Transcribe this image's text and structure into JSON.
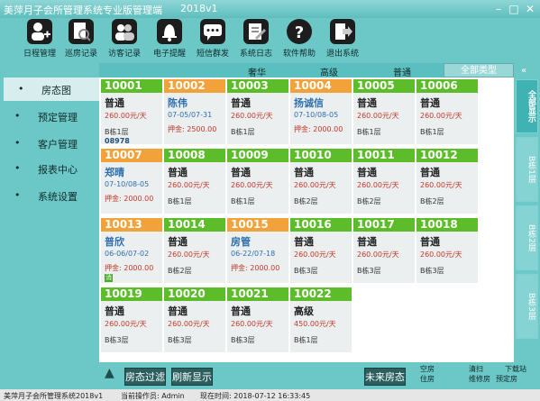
{
  "app": {
    "title": "美萍月子会所管理系统专业版管理端",
    "version": "2018v1"
  },
  "toolbar": [
    {
      "label": "日程管理",
      "icon": "user-add-icon"
    },
    {
      "label": "巡房记录",
      "icon": "document-search-icon"
    },
    {
      "label": "访客记录",
      "icon": "visitors-icon"
    },
    {
      "label": "电子提醒",
      "icon": "bell-icon"
    },
    {
      "label": "短信群发",
      "icon": "chat-icon"
    },
    {
      "label": "系统日志",
      "icon": "edit-log-icon"
    },
    {
      "label": "软件帮助",
      "icon": "help-icon"
    },
    {
      "label": "退出系统",
      "icon": "exit-icon"
    }
  ],
  "nav": [
    {
      "label": "房态图",
      "active": true
    },
    {
      "label": "预定管理",
      "active": false
    },
    {
      "label": "客户管理",
      "active": false
    },
    {
      "label": "报表中心",
      "active": false
    },
    {
      "label": "系统设置",
      "active": false
    }
  ],
  "categories": [
    "奢华",
    "高级",
    "普通",
    "全部类型"
  ],
  "rooms": [
    {
      "num": "10001",
      "color": "green",
      "type": "普通",
      "price": "260.00元/天",
      "floor": "B栋1层",
      "code": "08978"
    },
    {
      "num": "10002",
      "color": "orange",
      "type": "陈伟",
      "dates": "07-05/07-31",
      "deposit": "押金: 2500.00"
    },
    {
      "num": "10003",
      "color": "green",
      "type": "普通",
      "price": "260.00元/天",
      "floor": "B栋1层"
    },
    {
      "num": "10004",
      "color": "orange",
      "type": "扬诚信",
      "dates": "07-10/08-05",
      "deposit": "押金: 2000.00"
    },
    {
      "num": "10005",
      "color": "green",
      "type": "普通",
      "price": "260.00元/天",
      "floor": "B栋1层"
    },
    {
      "num": "10006",
      "color": "green",
      "type": "普通",
      "price": "260.00元/天",
      "floor": "B栋1层"
    },
    {
      "num": "10007",
      "color": "orange",
      "type": "郑晴",
      "dates": "07-10/08-05",
      "deposit": "押金: 2000.00"
    },
    {
      "num": "10008",
      "color": "green",
      "type": "普通",
      "price": "260.00元/天",
      "floor": "B栋1层"
    },
    {
      "num": "10009",
      "color": "green",
      "type": "普通",
      "price": "260.00元/天",
      "floor": "B栋1层"
    },
    {
      "num": "10010",
      "color": "green",
      "type": "普通",
      "price": "260.00元/天",
      "floor": "B栋2层"
    },
    {
      "num": "10011",
      "color": "green",
      "type": "普通",
      "price": "260.00元/天",
      "floor": "B栋2层"
    },
    {
      "num": "10012",
      "color": "green",
      "type": "普通",
      "price": "260.00元/天",
      "floor": "B栋2层"
    },
    {
      "num": "10013",
      "color": "orange",
      "type": "普欣",
      "dates": "06-06/07-02",
      "deposit": "押金: 2000.00",
      "badge": "消"
    },
    {
      "num": "10014",
      "color": "green",
      "type": "普通",
      "price": "260.00元/天",
      "floor": "B栋2层"
    },
    {
      "num": "10015",
      "color": "orange",
      "type": "房管",
      "dates": "06-22/07-18",
      "deposit": "押金: 2000.00"
    },
    {
      "num": "10016",
      "color": "green",
      "type": "普通",
      "price": "260.00元/天",
      "floor": "B栋3层"
    },
    {
      "num": "10017",
      "color": "green",
      "type": "普通",
      "price": "260.00元/天",
      "floor": "B栋3层"
    },
    {
      "num": "10018",
      "color": "green",
      "type": "普通",
      "price": "260.00元/天",
      "floor": "B栋3层"
    },
    {
      "num": "10019",
      "color": "green",
      "type": "普通",
      "price": "260.00元/天",
      "floor": "B栋3层"
    },
    {
      "num": "10020",
      "color": "green",
      "type": "普通",
      "price": "260.00元/天",
      "floor": "B栋3层"
    },
    {
      "num": "10021",
      "color": "green",
      "type": "普通",
      "price": "260.00元/天",
      "floor": "B栋3层"
    },
    {
      "num": "10022",
      "color": "green",
      "type": "高级",
      "price": "450.00元/天",
      "floor": "B栋1层"
    }
  ],
  "side_tabs": [
    "全部显示",
    "B栋1层",
    "B栋2层",
    "B栋3层"
  ],
  "bottom": {
    "filter": "房态过滤",
    "refresh": "刷新显示",
    "future": "未来房态",
    "opt1": "空房",
    "opt2": "住房",
    "opt3": "清扫",
    "opt4": "下载站",
    "opt5": "维修房",
    "opt6": "预定房"
  },
  "status": {
    "app": "美萍月子会所管理系统2018v1",
    "operator": "当前操作员: Admin",
    "time": "现在时间: 2018-07-12 16:33:45"
  },
  "colors": {
    "green": "#5cbc2a",
    "orange": "#f2a23a",
    "teal": "#6cc7c7"
  }
}
